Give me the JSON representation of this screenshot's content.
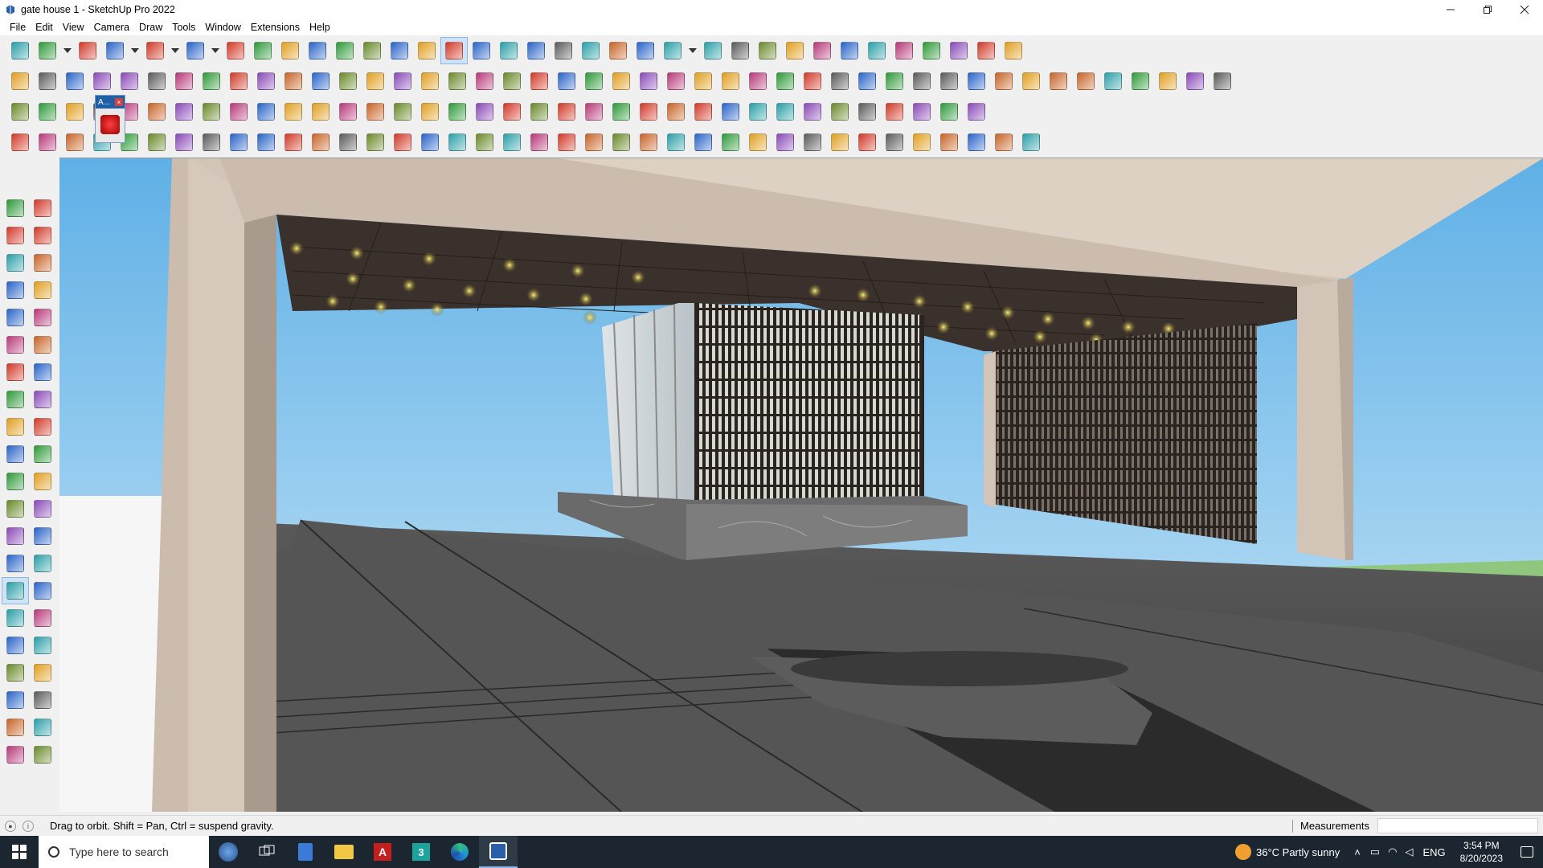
{
  "window": {
    "title": "gate house 1 - SketchUp Pro 2022",
    "controls": [
      "minimize-icon",
      "restore-icon",
      "close-icon"
    ]
  },
  "menubar": {
    "items": [
      "File",
      "Edit",
      "View",
      "Camera",
      "Draw",
      "Tools",
      "Window",
      "Extensions",
      "Help"
    ]
  },
  "toolbars": {
    "row1": [
      "zoom-icon",
      "select-icon",
      "dropdown-icon",
      "eraser-icon",
      "pencil-icon",
      "dropdown-icon",
      "arc-icon",
      "dropdown-icon",
      "rectangle-icon",
      "dropdown-icon",
      "push-pull-icon",
      "follow-me-icon",
      "move-icon",
      "rotate-icon",
      "scale-icon",
      "tape-measure-icon",
      "text-icon",
      "paint-bucket-icon",
      "orbit-icon",
      "pan-icon",
      "zoom-icon",
      "zoom-extents-icon",
      "section-icon",
      "section-fill-icon",
      "section-display-icon",
      "axes-icon",
      "profile-icon",
      "dropdown-icon",
      "component-icon",
      "group-icon",
      "sandbox-icon",
      "solid-icon",
      "outer-shell-icon",
      "intersect-icon",
      "union-icon",
      "subtract-icon",
      "trim-icon",
      "undo-icon",
      "redo-icon",
      "3d-warehouse-icon"
    ],
    "row2": [
      "box-icon",
      "wire-box-icon",
      "shaded-box-icon",
      "push-icon",
      "extrude-n-icon",
      "extrude-e-icon",
      "extrude-r-icon",
      "extrude-v-icon",
      "extrude-n2-icon",
      "extrude-x-icon",
      "extrude-f-icon",
      "curve-icon",
      "line-blue-icon",
      "line-purple-icon",
      "line-violet-icon",
      "soap-skin-icon",
      "terrain-icon",
      "house-1-icon",
      "house-2-icon",
      "house-3-icon",
      "house-4-icon",
      "house-5-icon",
      "house-6-icon",
      "fx-dropdown-icon",
      "cut-icon",
      "pencil-red-icon",
      "square-icon",
      "circle-icon",
      "hexagon-icon",
      "ellipse-icon",
      "parallelogram-icon",
      "arc-2-icon",
      "arc-3-icon",
      "bezier-icon",
      "spline-icon",
      "spiral-icon",
      "measure-red-icon",
      "eraser-pink-icon",
      "roof-icon",
      "grid-icon",
      "box-3d-icon",
      "box-3d-2-icon",
      "box-3d-3-icon",
      "box-3d-4-icon",
      "box-3d-5-icon"
    ],
    "row3": [
      "blue-plane-icon",
      "blue-plane-2-icon",
      "yellow-plane-icon",
      "plane-outline-icon",
      "plane-red-icon",
      "loop-icon",
      "rect-red-icon",
      "rect-list-icon",
      "panel-icon",
      "wood-icon",
      "bend-icon",
      "path-icon",
      "cross-red-icon",
      "cross-green-icon",
      "cross-blue-icon",
      "cone-icon",
      "cone-2-icon",
      "warning-icon",
      "curl-icon",
      "curl-2-icon",
      "curl-3-icon",
      "arrows-icon",
      "box-brown-icon",
      "undo-red-icon",
      "tree-icon",
      "flow-icon",
      "flow-2-icon",
      "gem-icon",
      "array-icon",
      "array-2-icon",
      "frame-icon",
      "grid-orange-icon",
      "grid-orange-2-icon",
      "dots-icon",
      "curve-dots-icon",
      "layout-icon"
    ],
    "row4": [
      "polyline-icon",
      "dotted-curve-icon",
      "fire-icon",
      "plane-dotted-icon",
      "plane-outline-2-icon",
      "stair-icon",
      "stair-2-icon",
      "stair-3-icon",
      "curve-path-icon",
      "corner-icon",
      "corner-2-icon",
      "line-red-icon",
      "bend-red-icon",
      "cube-frame-icon",
      "pyramid-icon",
      "columns-icon",
      "spring-icon",
      "hand-icon",
      "sheet-icon",
      "arrow-cluster-icon",
      "layers-icon",
      "line-grey-icon",
      "lines-icon",
      "lines-2-icon",
      "lines-3-icon",
      "block-icon",
      "stack-icon",
      "stack-2-icon",
      "stack-3-icon",
      "stack-4-icon",
      "mesh-icon",
      "stripes-icon",
      "stripes-2-icon",
      "star-dark-icon",
      "star-dark-2-icon",
      "plane-dark-icon",
      "stair-dark-icon",
      "shape-icon"
    ]
  },
  "lefttools": [
    "select-icon",
    "orbit-icon",
    "paint-icon",
    "eraser-icon",
    "component-icon",
    "tape-icon",
    "pencil-icon",
    "freehand-icon",
    "rectangle-icon",
    "rotated-rect-icon",
    "circle-icon",
    "polygon-icon",
    "arc-icon",
    "arc-2-icon",
    "arc-3-icon",
    "pie-icon",
    "move-icon",
    "push-pull-icon",
    "rotate-icon",
    "follow-me-icon",
    "scale-icon",
    "offset-icon",
    "tape-measure-icon",
    "dimension-icon",
    "protractor-icon",
    "text-icon",
    "axes-icon",
    "3d-text-icon",
    "orbit-active-icon",
    "pan-icon",
    "zoom-icon",
    "zoom-window-icon",
    "zoom-extents-icon",
    "previous-view-icon",
    "position-camera-icon",
    "look-around-icon",
    "walk-icon",
    "section-icon",
    "section-2-icon",
    "section-3-icon",
    "section-4-icon",
    "section-5-icon"
  ],
  "floating": {
    "label": "A..."
  },
  "statusbar": {
    "hint": "Drag to orbit. Shift = Pan, Ctrl = suspend gravity.",
    "measurements_label": "Measurements",
    "measurements_value": ""
  },
  "taskbar": {
    "search_placeholder": "Type here to search",
    "weather": "36°C  Partly sunny",
    "language": "ENG",
    "time": "3:54 PM",
    "date": "8/20/2023"
  },
  "colors": {
    "sky": "#79c0ec",
    "ceiling": "#3a312d",
    "frame": "#d2c5b7",
    "floor": "#4d4d4d",
    "water": "#2b2b2b",
    "grass": "#8fc77f",
    "taskbar": "#1c2630"
  }
}
